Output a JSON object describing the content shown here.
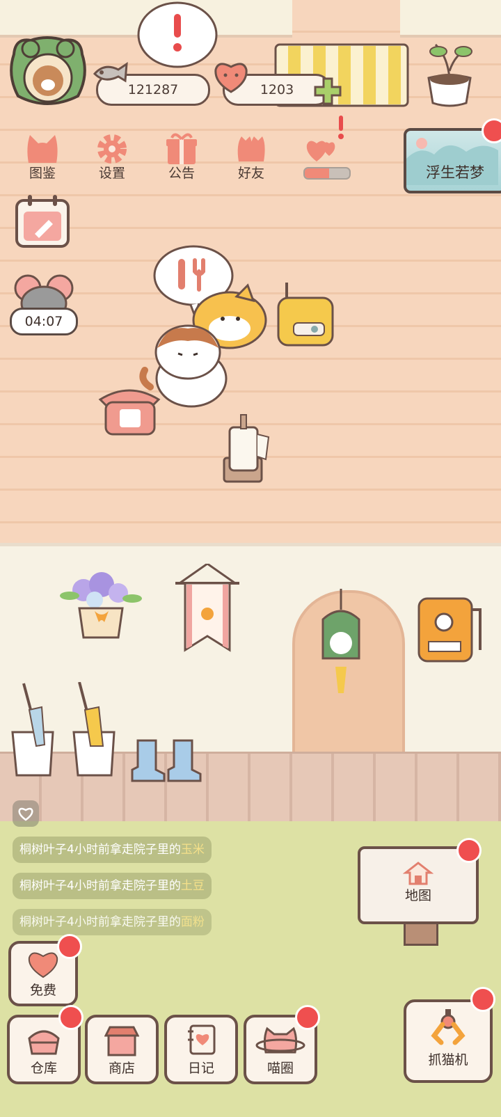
{
  "hud": {
    "coins": "121287",
    "hearts": "1203"
  },
  "menu": {
    "tujian": "图鉴",
    "shezhi": "设置",
    "gonggao": "公告",
    "haoyou": "好友",
    "gift_progress": 0.55
  },
  "dream_card": {
    "label": "浮生若梦"
  },
  "timer": {
    "value": "04:07"
  },
  "map": {
    "label": "地图"
  },
  "feed": [
    {
      "prefix": "桐树叶子4小时前拿走院子里的",
      "item": "玉米"
    },
    {
      "prefix": "桐树叶子4小时前拿走院子里的",
      "item": "土豆"
    },
    {
      "prefix": "桐树叶子4小时前拿走院子里的",
      "item": "面粉"
    }
  ],
  "bottom": {
    "free": "免费",
    "cangku": "仓库",
    "shangdian": "商店",
    "riji": "日记",
    "miaoquan": "喵圈",
    "zhuamaoji": "抓猫机"
  },
  "colors": {
    "badge_red": "#ef4f4f",
    "outline": "#6b5148",
    "accent_pink": "#f08a78"
  }
}
